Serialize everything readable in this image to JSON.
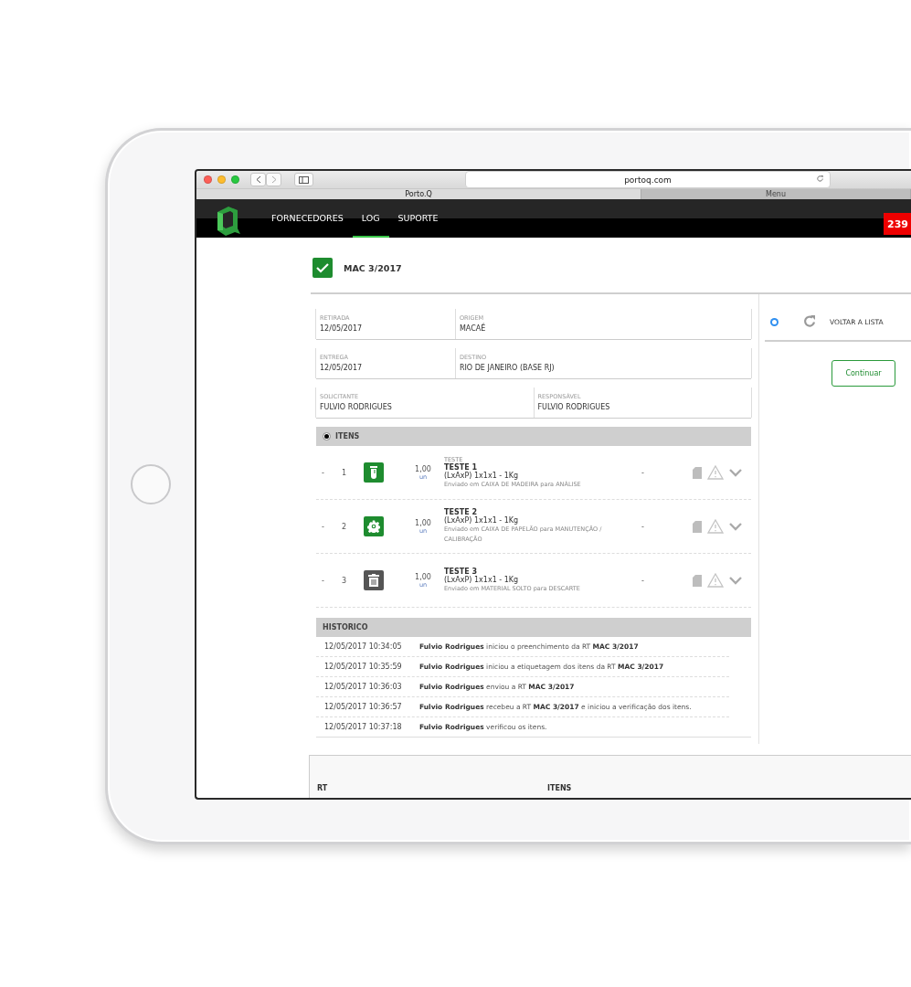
{
  "browser": {
    "url": "portoq.com",
    "tabs": [
      {
        "label": "Porto.Q",
        "selected": true
      },
      {
        "label": "Menu",
        "selected": false
      }
    ]
  },
  "nav": {
    "items": [
      {
        "label": "FORNECEDORES",
        "selected": false
      },
      {
        "label": "LOG",
        "selected": true
      },
      {
        "label": "SUPORTE",
        "selected": false
      }
    ],
    "badge": "239"
  },
  "record": {
    "title": "MAC 3/2017",
    "checked": true
  },
  "fields": [
    [
      {
        "label": "RETIRADA",
        "value": "12/05/2017"
      },
      {
        "label": "ORIGEM",
        "value": "MACAÉ"
      }
    ],
    [
      {
        "label": "ENTREGA",
        "value": "12/05/2017"
      },
      {
        "label": "DESTINO",
        "value": "RIO DE JANEIRO (BASE RJ)"
      }
    ],
    [
      {
        "label": "SOLICITANTE",
        "value": "FULVIO RODRIGUES"
      },
      {
        "label": "RESPONSÁVEL",
        "value": "FULVIO RODRIGUES"
      }
    ]
  ],
  "items": {
    "title": "ITENS",
    "selected": true,
    "rows": [
      {
        "dash": "-",
        "number": "1",
        "kind": "tube",
        "color": "#1e8c2f",
        "quantity": "1,00",
        "unit": "un",
        "category": "TESTE",
        "name": "TESTE 1",
        "size": "(LxAxP) 1x1x1 - 1Kg",
        "note": "Enviado em CAIXA DE MADEIRA para ANÁLISE",
        "status": "-"
      },
      {
        "dash": "-",
        "number": "2",
        "kind": "gear",
        "color": "#1e8c2f",
        "quantity": "1,00",
        "unit": "un",
        "name": "TESTE 2",
        "size": "(LxAxP) 1x1x1 - 1Kg",
        "note": "Enviado em CAIXA DE PAPELÃO para MANUTENÇÃO / CALIBRAÇÃO",
        "status": "-"
      },
      {
        "dash": "-",
        "number": "3",
        "kind": "trash",
        "color": "#555555",
        "quantity": "1,00",
        "unit": "un",
        "name": "TESTE 3",
        "size": "(LxAxP) 1x1x1 - 1Kg",
        "note": "Enviado em MATERIAL SOLTO para DESCARTE",
        "status": "-"
      }
    ]
  },
  "history": {
    "title": "HISTORICO",
    "rows": [
      {
        "time": "12/05/2017 10:34:05",
        "text": "**Fulvio Rodrigues** iniciou o preenchimento da RT **MAC 3/2017**"
      },
      {
        "time": "12/05/2017 10:35:59",
        "text": "**Fulvio Rodrigues** iniciou a etiquetagem dos itens da RT **MAC 3/2017**"
      },
      {
        "time": "12/05/2017 10:36:03",
        "text": "**Fulvio Rodrigues** enviou a RT **MAC 3/2017**"
      },
      {
        "time": "12/05/2017 10:36:57",
        "text": "**Fulvio Rodrigues** recebeu a RT **MAC 3/2017** e iniciou a verificação dos itens."
      },
      {
        "time": "12/05/2017 10:37:18",
        "text": "**Fulvio Rodrigues** verificou os itens."
      }
    ]
  },
  "side": {
    "option": {
      "label": "VOLTAR A LISTA",
      "selected": true
    },
    "button": "Continuar"
  },
  "table": {
    "columns": [
      "RT",
      "ITENS"
    ]
  }
}
